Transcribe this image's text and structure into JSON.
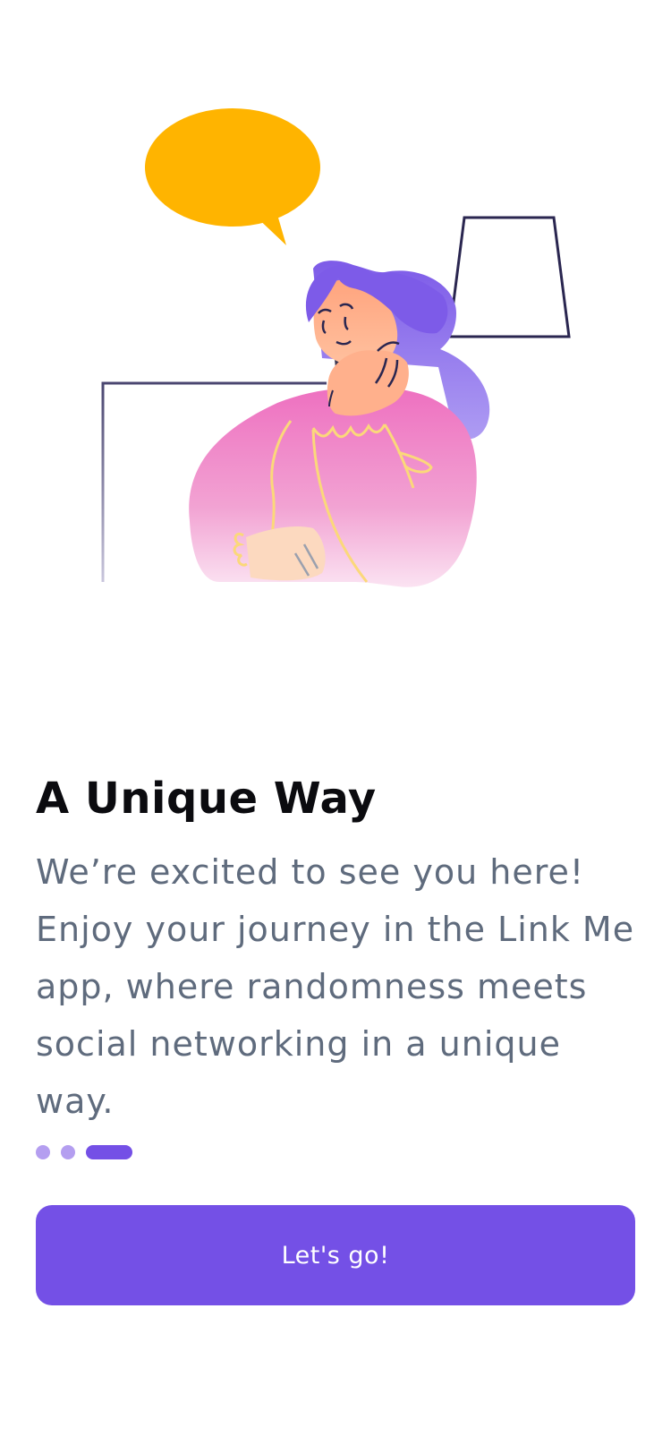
{
  "onboarding": {
    "title": "A Unique Way",
    "description": "We’re excited to see you here! Enjoy your journey in the Link Me app, where randomness meets social networking in a unique way.",
    "pagination": {
      "total": 3,
      "active_index": 2
    },
    "cta_label": "Let's go!"
  },
  "colors": {
    "accent": "#7450E6",
    "accent_light": "#B49EF0",
    "speech_bubble": "#FFB400",
    "heading": "#0B0B0F",
    "body_text": "#5F6B7D"
  }
}
